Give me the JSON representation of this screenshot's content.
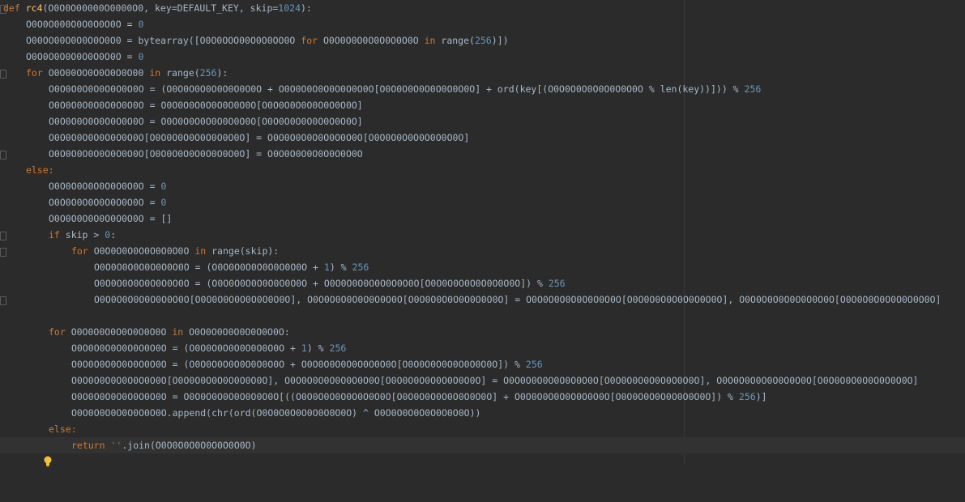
{
  "code_lines": [
    "def rc4(O0O0O00000O0000O0, key=DEFAULT_KEY, skip=1024):",
    "O0O0O000O0O0O0O0O = 0",
    "O00OO00O0O0O0O0O0 = bytearray([O0O0OOO00O0O0OO0O for O0O0O0O0O0O0O0O0O in range(256)])",
    "O0O0O0O0O0O0O0O0O = 0",
    "for O0O00OO0O0O0O0O00 in range(256):",
    "O0O0O0O0O0O0O0O0O = (O0O0O0O0O0O0O0O0O + O0O0O0O0O0O0O0O0O[O0O0O0O0O0O0O0O0O] + ord(key[(O0O0O0O0O0O0O0O0O % len(key))])) % 256",
    "O0O0O0O0O0O0O0O0O = O0O0O0O0O0O0O0O0O[O0O0O0O0O0O0O0O0O]",
    "O0O0O0O0O0O0O0O0O = O0O0O0O0O0O0O0O0O[O0O0O0O0O0O0O0O0O]",
    "O0O0O0O0O0O0O0O0O[O0O0O0O0O0O0O0O0O] = O0O0O0O0O0O0O0O0O[O0O0O0O0O0O0O0O0O]",
    "O0O0O0O0O0O0O0O0O[O0O0O0O0O0O0O0O0O] = O0O0O0O0O0O0O0O0O",
    "else:",
    "O0O0O0O0O0O0O0O0O = 0",
    "O0O0O0O0O0O0O0O0O = 0",
    "O0O0O0O0O0O0O0O0O = []",
    "if skip > 0:",
    "for O0O0O0O0O0O0O0O0O in range(skip):",
    "O0O0O0O0O0O0O0O0O = (O0O0O0O0O0O0O0O0O + 1) % 256",
    "O0O0O0O0O0O0O0O0O = (O0O0O0O0O0O0O0O0O + O0O0O0O0O0O0O0O0O[O0O0O0O0O0O0O0O0O]) % 256",
    "O0O0O0O0O0O0O0O0O[O0O0O0O0O0O0O0O0O], O0O0O0O0O0O0O0O0O[O0O0O0O0O0O0O0O0O] = O0O0O0O0O0O0O0O0O[O0O0O0O0O0O0O0O0O], O0O0O0O0O0O0O0O0O[O0O0O0O0O0O0O0O0O]",
    "",
    "for O0O0O0O0O0O0O0O0O in O0O0O0O0O0O0O0O0O:",
    "O0O0O0O0O0O0O0O0O = (O0O0O0O0O0O0O0O0O + 1) % 256",
    "O0O0O0O0O0O0O0O0O = (O0O0O0O0O0O0O0O0O + O0O0O0O0O0O0O0O0O[O0O0O0O0O0O0O0O0O]) % 256",
    "O0O0O0O0O0O0O0O0O[O0O0O0O0O0O0O0O0O], O0O0O0O0O0O0O0O0O[O0O0O0O0O0O0O0O0O] = O0O0O0O0O0O0O0O0O[O0O0O0O0O0O0O0O0O], O0O0O0O0O0O0O0O0O[O0O0O0O0O0O0O0O0O]",
    "O0O0O0O0O0O0O0O0O = O0O0O0O0O0O0O0O0O[((O0O0O0O0O0O0O0O0O[O0O0O0O0O0O0O0O0O] + O0O0O0O0O0O0O0O0O[O0O0O0O0O0O0O0O0O]) % 256)]",
    "O0O0O0O0O0O0O0O0O.append(chr(ord(O0O0O0O0O0O0O0O0O) ^ O0O0O0O0O0O0O0O0O))",
    "else:",
    "return ''.join(O0O0O0O0O0O0O0O0O)"
  ],
  "icons": {
    "fold": "fold-marker-icon",
    "intention": "lightbulb-icon"
  },
  "colors": {
    "background": "#2b2b2b",
    "keyword": "#cc7832",
    "function": "#ffc66d",
    "number": "#6897bb",
    "string": "#6a8759",
    "text": "#a9b7c6"
  }
}
